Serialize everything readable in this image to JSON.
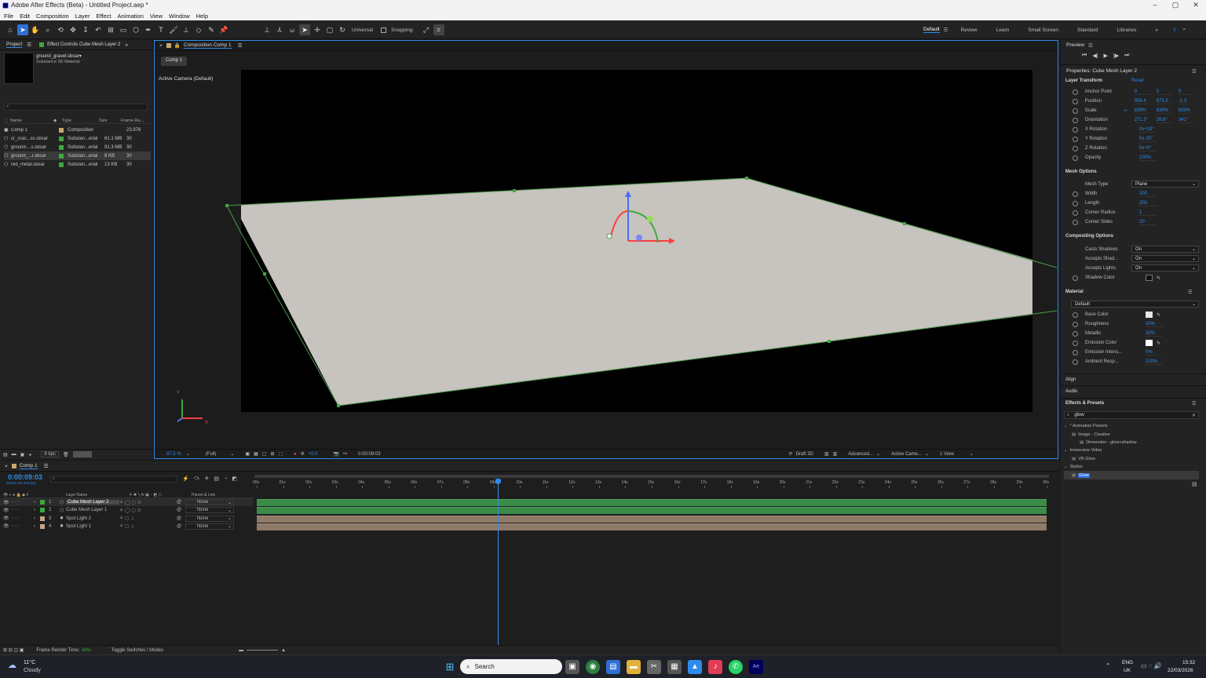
{
  "window": {
    "title": "Adobe After Effects (Beta) - Untitled Project.aep *",
    "min": "–",
    "max": "▢",
    "close": "✕"
  },
  "menu": [
    "File",
    "Edit",
    "Composition",
    "Layer",
    "Effect",
    "Animation",
    "View",
    "Window",
    "Help"
  ],
  "toolbar": {
    "universal": "Universal",
    "snapping": "Snapping"
  },
  "workspaces": [
    "Default",
    "Review",
    "Learn",
    "Small Screen",
    "Standard",
    "Libraries"
  ],
  "project": {
    "tab": "Project",
    "effect_tab": "Effect Controls Cube Mesh Layer 2",
    "selected_name": "ground_gravel.sbsar▾",
    "selected_type": "Substance 3D Material",
    "search_placeholder": "",
    "columns": [
      "Name",
      "Type",
      "Size",
      "Frame Ra..."
    ],
    "items": [
      {
        "name": "Comp 1",
        "type": "Composition",
        "size": "",
        "fps": "23.976",
        "color": "#c9a96b"
      },
      {
        "name": "cr_crac...ss.sbsar",
        "type": "Substan...erial",
        "size": "61.1 MB",
        "fps": "30",
        "color": "#3fa83f"
      },
      {
        "name": "ground-...s.sbsar",
        "type": "Substan...erial",
        "size": "91.3 MB",
        "fps": "30",
        "color": "#3fa83f"
      },
      {
        "name": "ground_...l.sbsar",
        "type": "Substan...erial",
        "size": "8 KB",
        "fps": "30",
        "color": "#3fa83f"
      },
      {
        "name": "red_metal.sbsar",
        "type": "Substan...erial",
        "size": "13 KB",
        "fps": "30",
        "color": "#3fa83f"
      }
    ],
    "bpc": "8 bpc"
  },
  "composition": {
    "tab": "Composition Comp 1",
    "subtab": "Comp 1",
    "camera_label": "Active Camera (Default)",
    "zoom": "87.5 %",
    "resolution": "(Full)",
    "exposure": "+0.0",
    "timecode": "0:00:09:03",
    "renderer": "Draft 3D",
    "advanced": "Advanced...",
    "camera_select": "Active Came...",
    "view": "1 View",
    "axis_y": "Y",
    "axis_x": "X"
  },
  "preview": {
    "tab": "Preview",
    "controls": [
      "⏮",
      "◀|",
      "▶",
      "|▶",
      "⏭"
    ]
  },
  "properties": {
    "title": "Properties: Cube Mesh Layer 2",
    "layer_transform": "Layer Transform",
    "reset": "Reset",
    "transform": [
      {
        "label": "Anchor Point",
        "values": [
          "0",
          "0",
          "0"
        ]
      },
      {
        "label": "Position",
        "values": [
          "956.4",
          "673.5",
          "-1.3"
        ]
      },
      {
        "label": "Scale",
        "values": [
          "839%",
          "839%",
          "839%"
        ]
      },
      {
        "label": "Orientation",
        "values": [
          "271.3°",
          "28.8°",
          "341°"
        ]
      },
      {
        "label": "X Rotation",
        "values": [
          "0x+19°"
        ]
      },
      {
        "label": "Y Rotation",
        "values": [
          "0x-25°"
        ]
      },
      {
        "label": "Z Rotation",
        "values": [
          "0x+0°"
        ]
      },
      {
        "label": "Opacity",
        "values": [
          "100%"
        ]
      }
    ],
    "mesh_options": "Mesh Options",
    "mesh_type_label": "Mesh Type",
    "mesh_type": "Plane",
    "mesh": [
      {
        "label": "Width",
        "value": "200"
      },
      {
        "label": "Length",
        "value": "200"
      },
      {
        "label": "Corner Radius",
        "value": "1"
      },
      {
        "label": "Corner Sides",
        "value": "20"
      }
    ],
    "compositing_options": "Compositing Options",
    "compositing": [
      {
        "label": "Casts Shadows",
        "value": "On"
      },
      {
        "label": "Accepts Shad...",
        "value": "On"
      },
      {
        "label": "Accepts Lights",
        "value": "On"
      }
    ],
    "shadow_color": "Shadow Color",
    "material": "Material",
    "material_select": "Default",
    "material_props": [
      {
        "label": "Base Color",
        "value": "",
        "swatch": "#e6e6e6"
      },
      {
        "label": "Roughness",
        "value": "30%"
      },
      {
        "label": "Metallic",
        "value": "30%"
      },
      {
        "label": "Emission Color",
        "value": "",
        "swatch": "#ffffff"
      },
      {
        "label": "Emission Intens...",
        "value": "0%"
      },
      {
        "label": "Ambient Resp...",
        "value": "100%"
      }
    ],
    "align": "Align",
    "audio": "Audio"
  },
  "effects": {
    "title": "Effects & Presets",
    "search": "glow",
    "tree": [
      {
        "label": "* Animation Presets",
        "indent": 0
      },
      {
        "label": "Image - Creative",
        "indent": 1
      },
      {
        "label": "Dimension - glow+shadow",
        "indent": 2
      },
      {
        "label": "Immersive Video",
        "indent": 0
      },
      {
        "label": "VR Glow",
        "indent": 1
      },
      {
        "label": "Stylize",
        "indent": 0
      },
      {
        "label": "Glow",
        "indent": 1
      }
    ]
  },
  "timeline": {
    "tab": "Comp 1",
    "timecode": "0:00:09:03",
    "fps_note": "00219 (23.976 fps)",
    "col_layer": "Layer Name",
    "col_parent": "Parent & Link",
    "ruler": [
      "00s",
      "01s",
      "02s",
      "03s",
      "04s",
      "05s",
      "06s",
      "07s",
      "08s",
      "09s",
      "10s",
      "11s",
      "12s",
      "13s",
      "14s",
      "15s",
      "16s",
      "17s",
      "18s",
      "19s",
      "20s",
      "21s",
      "22s",
      "23s",
      "24s",
      "25s",
      "26s",
      "27s",
      "28s",
      "29s",
      "30s"
    ],
    "playhead_fraction": 0.305,
    "layers": [
      {
        "num": "1",
        "name": "Cube Mesh Layer 2",
        "parent": "None",
        "color": "#3fa83f",
        "bar": "#3a8c46"
      },
      {
        "num": "2",
        "name": "Cube Mesh Layer 1",
        "parent": "None",
        "color": "#3fa83f",
        "bar": "#3a8c46"
      },
      {
        "num": "3",
        "name": "Spot Light 2",
        "parent": "None",
        "color": "#c9a386",
        "bar": "#8f7a68"
      },
      {
        "num": "4",
        "name": "Spot Light 1",
        "parent": "None",
        "color": "#c9a386",
        "bar": "#8f7a68"
      }
    ],
    "render_time_label": "Frame Render Time:",
    "render_time": "8ms",
    "toggle": "Toggle Switches / Modes"
  },
  "taskbar": {
    "temp": "11°C",
    "weather": "Cloudy",
    "search": "Search",
    "lang": "ENG",
    "region": "UK",
    "time": "15:32",
    "date": "22/03/2026"
  }
}
